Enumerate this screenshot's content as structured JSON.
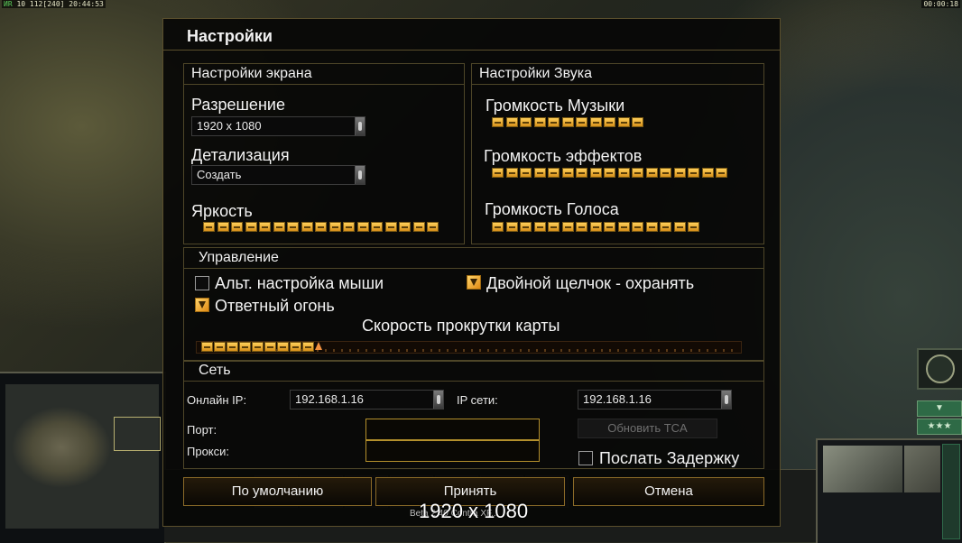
{
  "hud": {
    "top_left_a": "ИR",
    "top_left_b": "10 112",
    "top_left_c": "[240]",
    "top_left_time": "20:44:53",
    "top_right_time": "00:00:18"
  },
  "dialog": {
    "title": "Настройки",
    "screen": {
      "header": "Настройки экрана",
      "resolution_label": "Разрешение",
      "resolution_value": "1920 x 1080",
      "detail_label": "Детализация",
      "detail_value": "Создать",
      "brightness_label": "Яркость",
      "brightness_level": 1.0
    },
    "sound": {
      "header": "Настройки Звука",
      "music_label": "Громкость Музыки",
      "music_level": 1.0,
      "effects_label": "Громкость эффектов",
      "effects_level": 1.0,
      "voice_label": "Громкость Голоса",
      "voice_level": 1.0
    },
    "control": {
      "header": "Управление",
      "alt_mouse_label": "Альт. настройка мыши",
      "alt_mouse_checked": false,
      "double_click_label": "Двойной щелчок - охранять",
      "double_click_checked": true,
      "return_fire_label": "Ответный огонь",
      "return_fire_checked": true,
      "scroll_speed_label": "Скорость прокрутки карты",
      "scroll_speed_level": 0.2
    },
    "network": {
      "header": "Сеть",
      "online_ip_label": "Онлайн IP:",
      "online_ip_value": "192.168.1.16",
      "lan_ip_label": "IP сети:",
      "lan_ip_value": "192.168.1.16",
      "port_label": "Порт:",
      "port_value": "",
      "proxy_label": "Прокси:",
      "proxy_value": "",
      "update_button": "Обновить TCA",
      "send_delay_label": "Послать Задержку",
      "send_delay_checked": false
    },
    "buttons": {
      "defaults": "По умолчанию",
      "accept": "Принять",
      "cancel": "Отмена"
    }
  },
  "overlay": {
    "resolution_text": "1920 x 1080",
    "version_text": "Beta 2.40 Contra XF..."
  }
}
